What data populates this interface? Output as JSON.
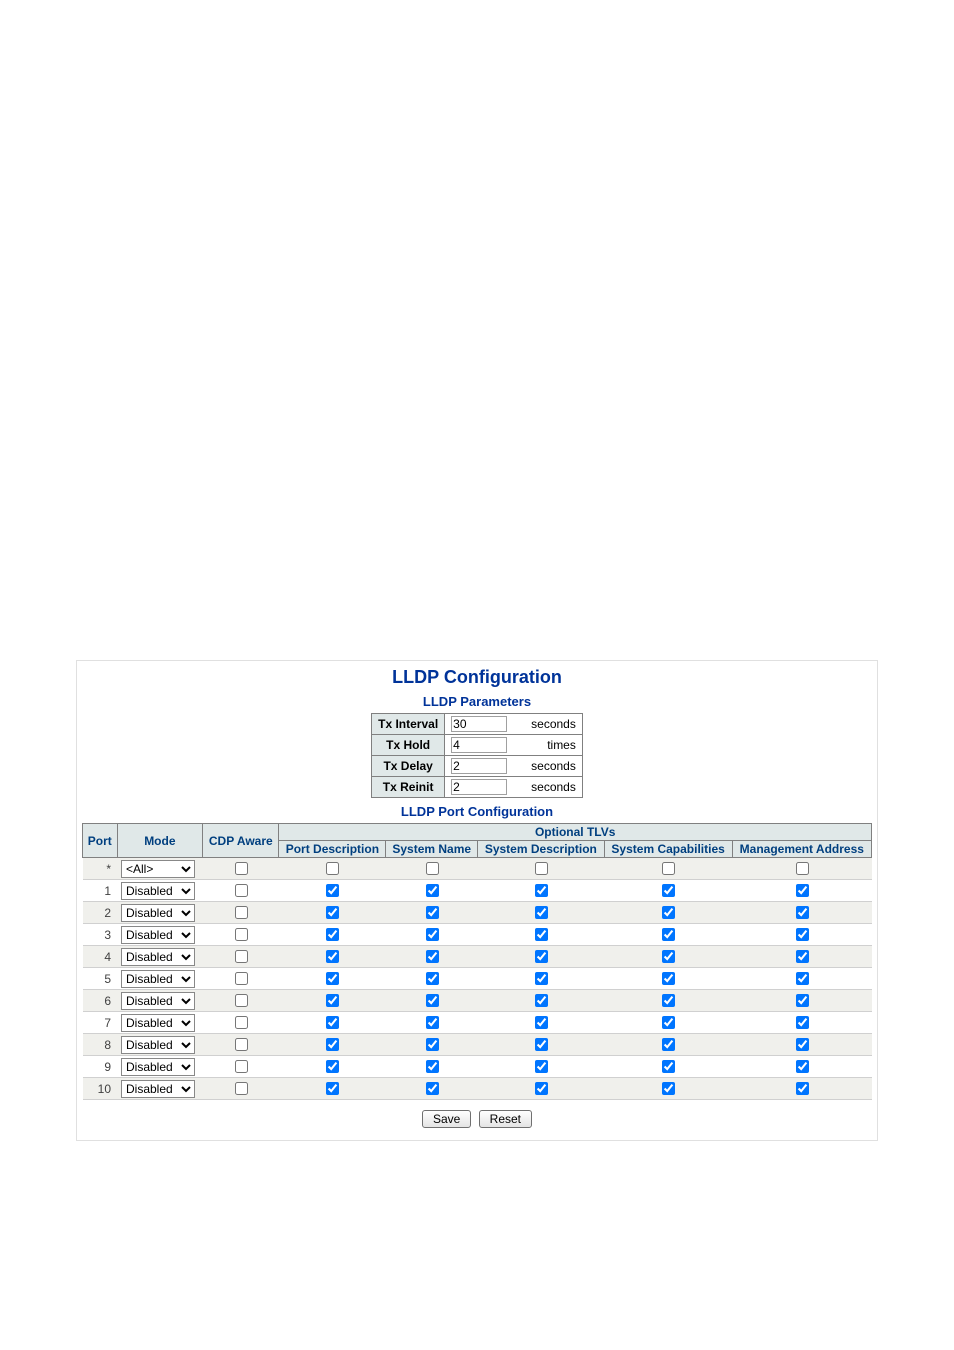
{
  "page": {
    "title": "LLDP Configuration",
    "section1": "LLDP Parameters",
    "section2": "LLDP Port Configuration"
  },
  "params": [
    {
      "name": "Tx Interval",
      "value": "30",
      "unit": "seconds"
    },
    {
      "name": "Tx Hold",
      "value": "4",
      "unit": "times"
    },
    {
      "name": "Tx Delay",
      "value": "2",
      "unit": "seconds"
    },
    {
      "name": "Tx Reinit",
      "value": "2",
      "unit": "seconds"
    }
  ],
  "port_headers": {
    "port": "Port",
    "mode": "Mode",
    "cdp": "CDP Aware",
    "optional": "Optional TLVs",
    "portdesc": "Port Description",
    "sysname": "System Name",
    "sysdesc": "System Description",
    "syscap": "System Capabilities",
    "mgmt": "Management Address"
  },
  "all_row_mode": "<All>",
  "port_mode_value": "Disabled",
  "port_count": 10,
  "buttons": {
    "save": "Save",
    "reset": "Reset"
  }
}
